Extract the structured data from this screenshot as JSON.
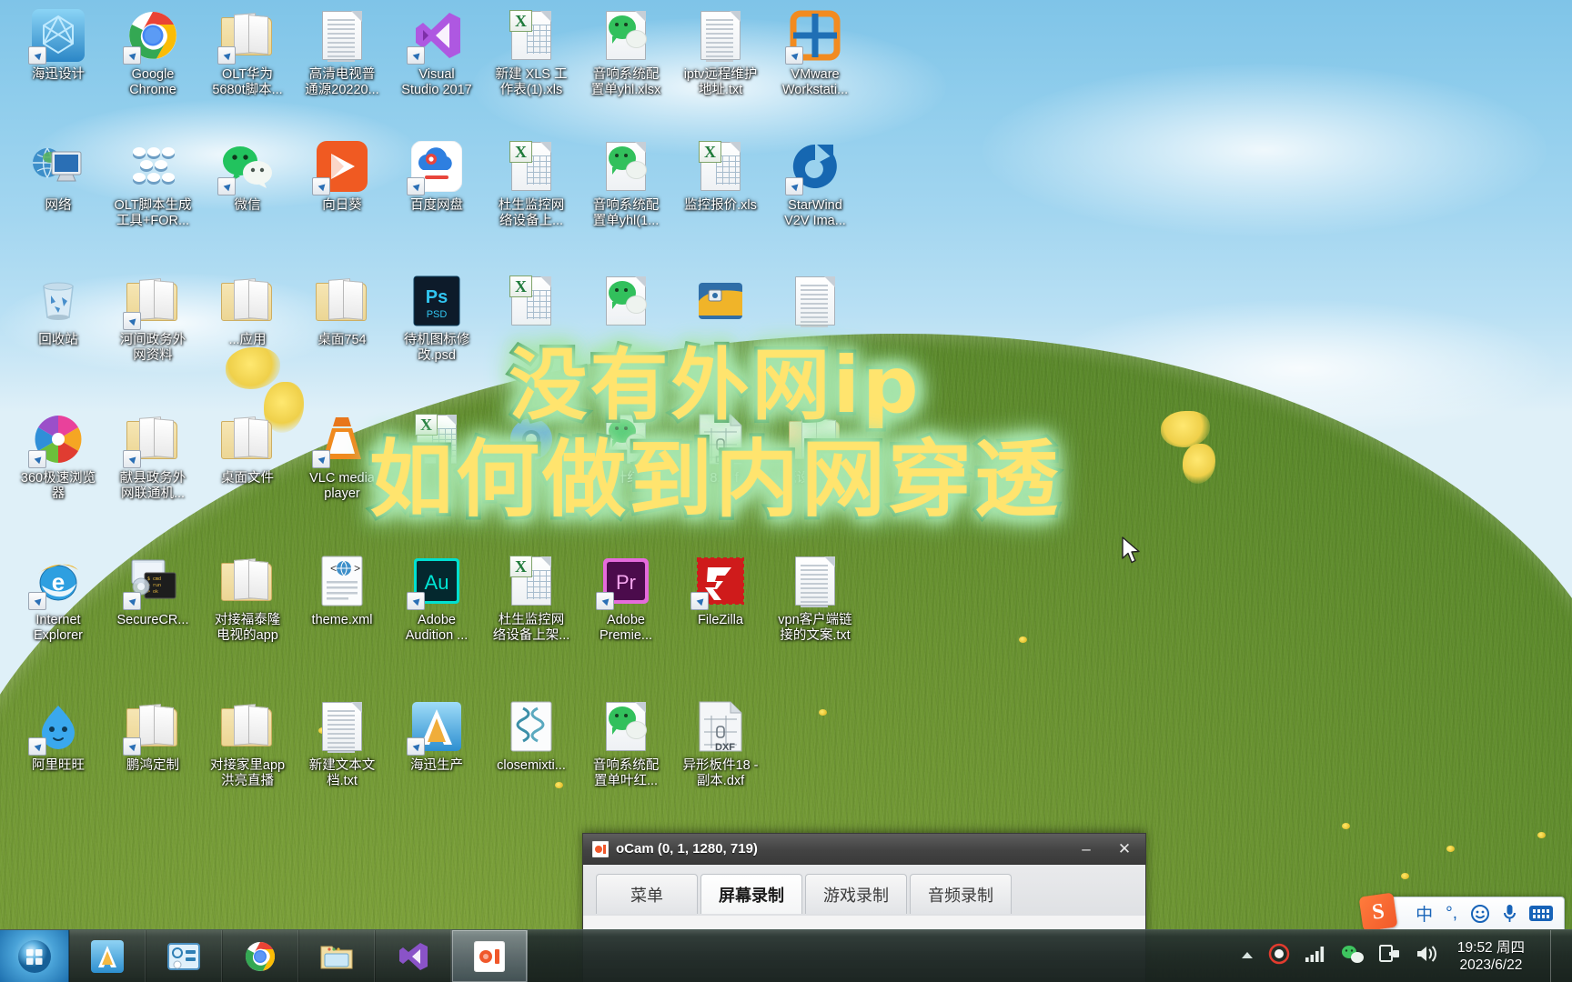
{
  "desktop": {
    "icons": [
      {
        "label": "海迅设计",
        "type": "app-haixun",
        "shortcut": true,
        "col": 0,
        "row": 0
      },
      {
        "label": "Google\nChrome",
        "type": "app-chrome",
        "shortcut": true,
        "col": 1,
        "row": 0
      },
      {
        "label": "OLT华为\n5680t脚本...",
        "type": "folder",
        "shortcut": true,
        "col": 2,
        "row": 0
      },
      {
        "label": "高清电视普\n通源20220...",
        "type": "doc-notepad",
        "shortcut": false,
        "col": 3,
        "row": 0
      },
      {
        "label": "Visual\nStudio 2017",
        "type": "app-vs",
        "shortcut": true,
        "col": 4,
        "row": 0
      },
      {
        "label": "新建 XLS 工\n作表(1).xls",
        "type": "doc-xls",
        "shortcut": false,
        "col": 5,
        "row": 0
      },
      {
        "label": "音响系统配\n置单yhl.xlsx",
        "type": "doc-wechat",
        "shortcut": false,
        "col": 6,
        "row": 0
      },
      {
        "label": "iptv远程维护\n地址.txt",
        "type": "doc-notepad",
        "shortcut": false,
        "col": 7,
        "row": 0
      },
      {
        "label": "VMware\nWorkstati...",
        "type": "app-vmware",
        "shortcut": true,
        "col": 8,
        "row": 0
      },
      {
        "label": "网络",
        "type": "app-network",
        "shortcut": false,
        "col": 0,
        "row": 1
      },
      {
        "label": "OLT脚本生成\n工具+FOR...",
        "type": "app-olttool",
        "shortcut": false,
        "col": 1,
        "row": 1
      },
      {
        "label": "微信",
        "type": "app-wechat",
        "shortcut": true,
        "col": 2,
        "row": 1
      },
      {
        "label": "向日葵",
        "type": "app-sunlogin",
        "shortcut": true,
        "col": 3,
        "row": 1
      },
      {
        "label": "百度网盘",
        "type": "app-baidupan",
        "shortcut": true,
        "col": 4,
        "row": 1
      },
      {
        "label": "杜生监控网\n络设备上...",
        "type": "doc-xls",
        "shortcut": false,
        "col": 5,
        "row": 1
      },
      {
        "label": "音响系统配\n置单yhl(1...",
        "type": "doc-wechat",
        "shortcut": false,
        "col": 6,
        "row": 1
      },
      {
        "label": "监控报价.xls",
        "type": "doc-xls",
        "shortcut": false,
        "col": 7,
        "row": 1
      },
      {
        "label": "StarWind\nV2V Ima...",
        "type": "app-starwind",
        "shortcut": true,
        "col": 8,
        "row": 1
      },
      {
        "label": "回收站",
        "type": "app-recyclebin",
        "shortcut": false,
        "col": 0,
        "row": 2
      },
      {
        "label": "河间政务外\n网资料",
        "type": "folder",
        "shortcut": true,
        "col": 1,
        "row": 2
      },
      {
        "label": "...应用",
        "type": "folder",
        "shortcut": false,
        "col": 2,
        "row": 2
      },
      {
        "label": "桌面754",
        "type": "folder",
        "shortcut": false,
        "col": 3,
        "row": 2
      },
      {
        "label": "待机图标修\n改.psd",
        "type": "doc-psd",
        "shortcut": false,
        "col": 4,
        "row": 2
      },
      {
        "label": "",
        "type": "doc-xls",
        "shortcut": false,
        "col": 5,
        "row": 2
      },
      {
        "label": "",
        "type": "doc-wechat",
        "shortcut": false,
        "col": 6,
        "row": 2
      },
      {
        "label": "",
        "type": "app-vpn",
        "shortcut": false,
        "col": 7,
        "row": 2
      },
      {
        "label": "",
        "type": "doc-notepad",
        "shortcut": false,
        "col": 8,
        "row": 2
      },
      {
        "label": "360极速浏览\n器",
        "type": "app-360",
        "shortcut": true,
        "col": 0,
        "row": 3
      },
      {
        "label": "献县政务外\n网联通机...",
        "type": "folder",
        "shortcut": true,
        "col": 1,
        "row": 3
      },
      {
        "label": "桌面文件",
        "type": "folder",
        "shortcut": false,
        "col": 2,
        "row": 3
      },
      {
        "label": "VLC media\nplayer",
        "type": "app-vlc",
        "shortcut": true,
        "col": 3,
        "row": 3
      },
      {
        "label": "",
        "type": "doc-xls",
        "shortcut": false,
        "col": 4,
        "row": 3
      },
      {
        "label": "",
        "type": "app-chromium",
        "shortcut": false,
        "col": 5,
        "row": 3
      },
      {
        "label": "置单叶红亮...",
        "type": "doc-wechat",
        "shortcut": false,
        "col": 6,
        "row": 3
      },
      {
        "label": "18.dxf",
        "type": "doc-dxf",
        "shortcut": false,
        "col": 7,
        "row": 3
      },
      {
        "label": "概设备生...",
        "type": "folder",
        "shortcut": false,
        "col": 8,
        "row": 3
      },
      {
        "label": "Internet\nExplorer",
        "type": "app-ie",
        "shortcut": true,
        "col": 0,
        "row": 4
      },
      {
        "label": "SecureCR...",
        "type": "app-securecrt",
        "shortcut": true,
        "col": 1,
        "row": 4
      },
      {
        "label": "对接福泰隆\n电视的app",
        "type": "folder",
        "shortcut": false,
        "col": 2,
        "row": 4
      },
      {
        "label": "theme.xml",
        "type": "doc-xml",
        "shortcut": false,
        "col": 3,
        "row": 4
      },
      {
        "label": "Adobe\nAudition ...",
        "type": "app-audition",
        "shortcut": true,
        "col": 4,
        "row": 4
      },
      {
        "label": "杜生监控网\n络设备上架...",
        "type": "doc-xls",
        "shortcut": false,
        "col": 5,
        "row": 4
      },
      {
        "label": "Adobe\nPremie...",
        "type": "app-premiere",
        "shortcut": true,
        "col": 6,
        "row": 4
      },
      {
        "label": "FileZilla",
        "type": "app-filezilla",
        "shortcut": true,
        "col": 7,
        "row": 4
      },
      {
        "label": "vpn客户端链\n接的文案.txt",
        "type": "doc-notepad",
        "shortcut": false,
        "col": 8,
        "row": 4
      },
      {
        "label": "阿里旺旺",
        "type": "app-aliwangwang",
        "shortcut": true,
        "col": 0,
        "row": 5
      },
      {
        "label": "鹏鸿定制",
        "type": "folder",
        "shortcut": true,
        "col": 1,
        "row": 5
      },
      {
        "label": "对接家里app\n洪亮直播",
        "type": "folder",
        "shortcut": false,
        "col": 2,
        "row": 5
      },
      {
        "label": "新建文本文\n档.txt",
        "type": "doc-notepad",
        "shortcut": false,
        "col": 3,
        "row": 5
      },
      {
        "label": "海迅生产",
        "type": "app-haixun2",
        "shortcut": true,
        "col": 4,
        "row": 5
      },
      {
        "label": "closemixti...",
        "type": "doc-script",
        "shortcut": false,
        "col": 5,
        "row": 5
      },
      {
        "label": "音响系统配\n置单叶红...",
        "type": "doc-wechat",
        "shortcut": false,
        "col": 6,
        "row": 5
      },
      {
        "label": "异形板件18 -\n副本.dxf",
        "type": "doc-dxf",
        "shortcut": false,
        "col": 7,
        "row": 5
      }
    ]
  },
  "caption": {
    "line1": "没有外网ip",
    "line2": "如何做到内网穿透",
    "fill_color": "#ffe46e",
    "stroke_color": "#1d7a3a",
    "glow_color": "#a8e6ad"
  },
  "ocam": {
    "title": "oCam (0, 1, 1280, 719)",
    "icon_name": "ocam-icon",
    "minimize_label": "–",
    "close_label": "✕",
    "tabs": [
      {
        "label": "菜单",
        "active": false
      },
      {
        "label": "屏幕录制",
        "active": true
      },
      {
        "label": "游戏录制",
        "active": false
      },
      {
        "label": "音频录制",
        "active": false
      }
    ]
  },
  "taskbar": {
    "start_label": "start-orb",
    "buttons": [
      {
        "name": "taskbar-haixun",
        "active": false
      },
      {
        "name": "taskbar-olttool",
        "active": false
      },
      {
        "name": "taskbar-chrome",
        "active": false
      },
      {
        "name": "taskbar-explorer",
        "active": false
      },
      {
        "name": "taskbar-vs",
        "active": false
      },
      {
        "name": "taskbar-ocam",
        "active": true
      }
    ],
    "tray": [
      {
        "name": "show-hidden-icons-arrow"
      },
      {
        "name": "ocam-tray-icon"
      },
      {
        "name": "network-signal-icon"
      },
      {
        "name": "wechat-tray-icon"
      },
      {
        "name": "usb-device-icon"
      },
      {
        "name": "volume-icon"
      }
    ],
    "clock": {
      "time": "19:52 周四",
      "date": "2023/6/22"
    }
  },
  "ime": {
    "logo_text": "S",
    "items": [
      "中",
      "°,",
      "☺",
      "mic",
      "kbd"
    ]
  }
}
